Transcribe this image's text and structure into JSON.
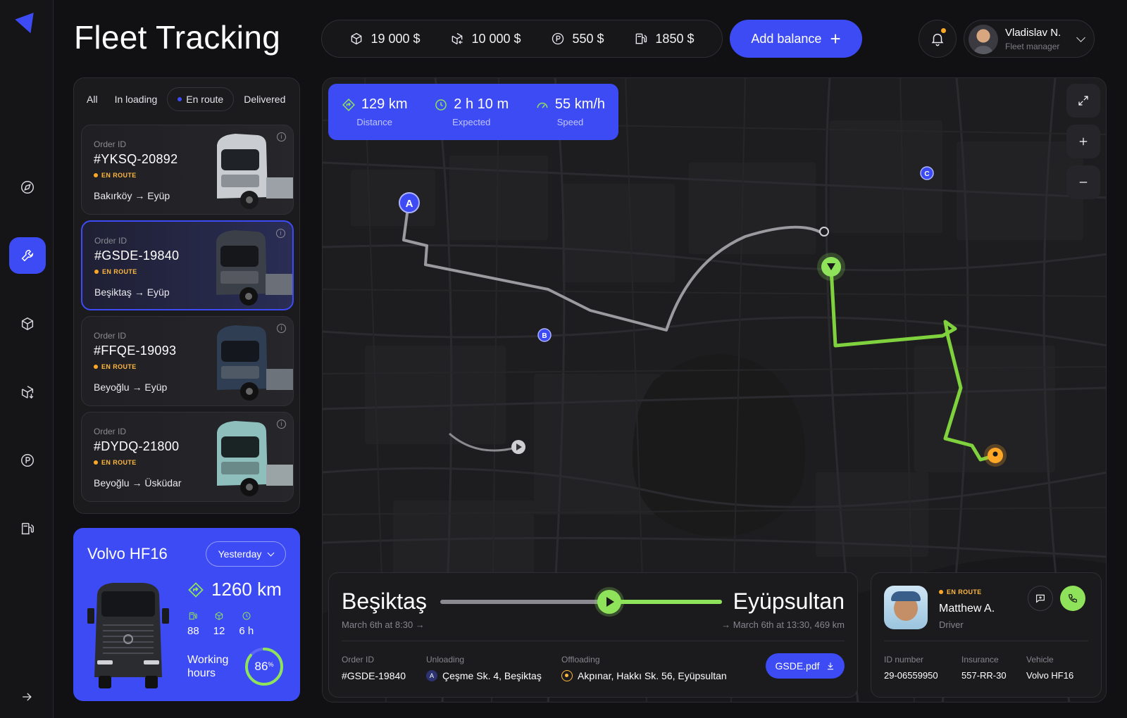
{
  "app": {
    "title": "Fleet Tracking"
  },
  "sidebar": {
    "items": [
      {
        "name": "navigation-icon"
      },
      {
        "name": "wrench-icon",
        "active": true
      },
      {
        "name": "cube-return-icon"
      },
      {
        "name": "cube-download-icon"
      },
      {
        "name": "parking-icon"
      },
      {
        "name": "fuel-icon"
      }
    ]
  },
  "balances": {
    "cargo": "19 000 $",
    "cargo_return": "10 000 $",
    "parking": "550 $",
    "fuel": "1850 $"
  },
  "header": {
    "add_balance": "Add balance",
    "user_name": "Vladislav N.",
    "user_role": "Fleet manager"
  },
  "filters": {
    "all": "All",
    "in_loading": "In loading",
    "en_route": "En route",
    "delivered": "Delivered"
  },
  "orders": [
    {
      "label": "Order ID",
      "id": "#YKSQ-20892",
      "status": "EN ROUTE",
      "from": "Bakırköy",
      "to": "Eyüp",
      "color": "#c9cdd2"
    },
    {
      "label": "Order ID",
      "id": "#GSDE-19840",
      "status": "EN ROUTE",
      "from": "Beşiktaş",
      "to": "Eyüp",
      "color": "#3b3f47"
    },
    {
      "label": "Order ID",
      "id": "#FFQE-19093",
      "status": "EN ROUTE",
      "from": "Beyoğlu",
      "to": "Eyüp",
      "color": "#2f3e52"
    },
    {
      "label": "Order ID",
      "id": "#DYDQ-21800",
      "status": "EN ROUTE",
      "from": "Beyoğlu",
      "to": "Üsküdar",
      "color": "#8fbfbd"
    }
  ],
  "vehicle": {
    "name": "Volvo HF16",
    "period": "Yesterday",
    "distance": "1260 km",
    "fuel": "88",
    "cargo": "12",
    "time": "6 h",
    "hours_label_1": "Working",
    "hours_label_2": "hours",
    "percent": 86,
    "percent_text": "86",
    "percent_unit": "%"
  },
  "trip": {
    "distance": "129 km",
    "distance_label": "Distance",
    "expected": "2 h 10 m",
    "expected_label": "Expected",
    "speed": "55 km/h",
    "speed_label": "Speed"
  },
  "map": {
    "markers": {
      "a": "A",
      "b": "B",
      "c": "C"
    }
  },
  "route": {
    "from": "Beşiktaş",
    "to": "Eyüpsultan",
    "from_time": "March 6th at 8:30",
    "to_time": "March 6th at 13:30, 469 km",
    "progress": 0.6,
    "order_label": "Order ID",
    "order_value": "#GSDE-19840",
    "unloading_label": "Unloading",
    "unloading_value": "Çeşme Sk. 4, Beşiktaş",
    "offloading_label": "Offloading",
    "offloading_value": "Akpınar, Hakkı Sk. 56, Eyüpsultan",
    "file": "GSDE.pdf"
  },
  "driver": {
    "status": "EN ROUTE",
    "name": "Matthew A.",
    "role": "Driver",
    "id_label": "ID number",
    "id_value": "29-06559950",
    "insurance_label": "Insurance",
    "insurance_value": "557-RR-30",
    "vehicle_label": "Vehicle",
    "vehicle_value": "Volvo HF16"
  },
  "colors": {
    "accent": "#3d4bf5",
    "green": "#8fe35a",
    "orange": "#ffa726"
  }
}
